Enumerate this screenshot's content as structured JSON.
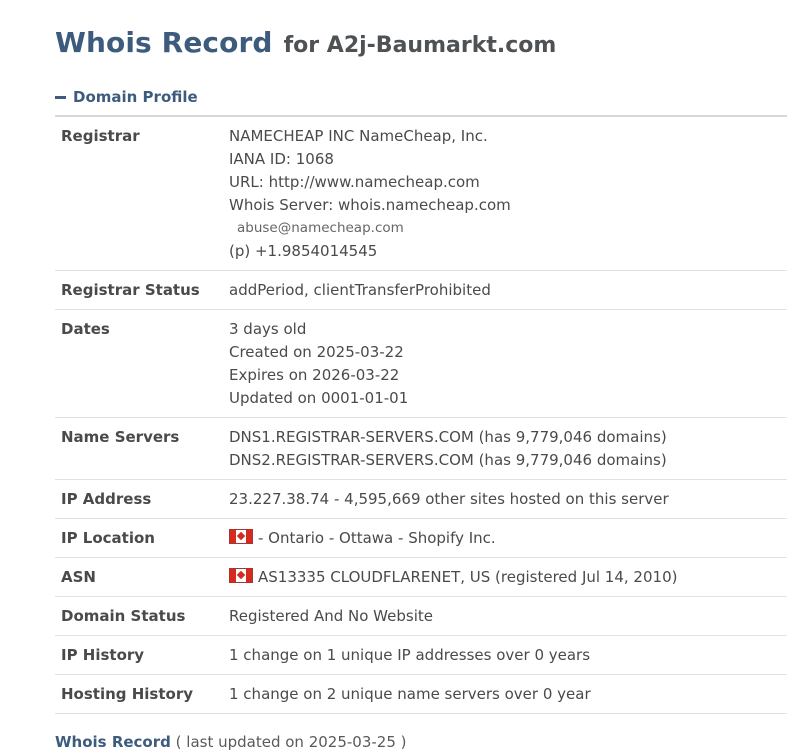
{
  "header": {
    "title": "Whois Record",
    "subtitle": "for A2j-Baumarkt.com"
  },
  "section": {
    "label": "Domain Profile",
    "toggle_icon": "minus-icon"
  },
  "rows": {
    "registrar": {
      "label": "Registrar",
      "name": "NAMECHEAP INC NameCheap, Inc.",
      "iana": "IANA ID: 1068",
      "url": "URL: http://www.namecheap.com",
      "whois_server": "Whois Server: whois.namecheap.com",
      "email": "abuse@namecheap.com",
      "phone": "(p) +1.9854014545"
    },
    "registrar_status": {
      "label": "Registrar Status",
      "value": "addPeriod, clientTransferProhibited"
    },
    "dates": {
      "label": "Dates",
      "age": "3 days old",
      "created": "Created on 2025-03-22",
      "expires": "Expires on 2026-03-22",
      "updated": "Updated on 0001-01-01"
    },
    "name_servers": {
      "label": "Name Servers",
      "ns1": "DNS1.REGISTRAR-SERVERS.COM (has 9,779,046 domains)",
      "ns2": "DNS2.REGISTRAR-SERVERS.COM (has 9,779,046 domains)"
    },
    "ip_address": {
      "label": "IP Address",
      "value": "23.227.38.74 - 4,595,669 other sites hosted on this server"
    },
    "ip_location": {
      "label": "IP Location",
      "flag": "canada-flag-icon",
      "value": "- Ontario - Ottawa - Shopify Inc."
    },
    "asn": {
      "label": "ASN",
      "flag": "canada-flag-icon",
      "value": "AS13335 CLOUDFLARENET, US (registered Jul 14, 2010)"
    },
    "domain_status": {
      "label": "Domain Status",
      "value": "Registered And No Website"
    },
    "ip_history": {
      "label": "IP History",
      "value": "1 change on 1 unique IP addresses over 0 years"
    },
    "hosting_history": {
      "label": "Hosting History",
      "value": "1 change on 2 unique name servers over 0 year"
    }
  },
  "footer": {
    "title": "Whois Record",
    "note": "( last updated on 2025-03-25 )"
  },
  "colors": {
    "accent": "#3d5b7d",
    "text": "#4a4a4a",
    "border": "#e2e2e2"
  }
}
